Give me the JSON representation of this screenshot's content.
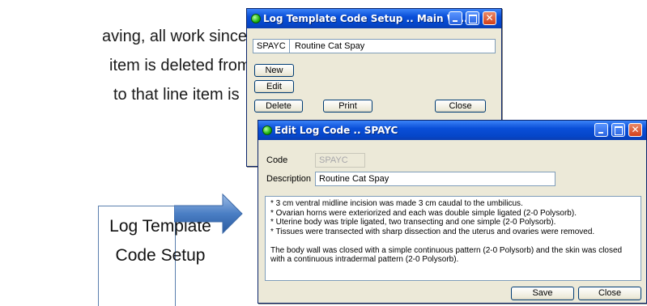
{
  "document": {
    "lines": [
      "aving, all work since",
      "item is deleted from",
      "to that line item is"
    ],
    "callout_lines": [
      "Log Template",
      "Code Setup"
    ]
  },
  "main_window": {
    "title": "Log Template Code Setup .. Main W...",
    "code_value": "SPAYC",
    "description_value": "Routine Cat Spay",
    "buttons": {
      "new": "New",
      "edit": "Edit",
      "delete": "Delete",
      "print": "Print",
      "close": "Close"
    }
  },
  "edit_window": {
    "title": "Edit Log Code .. SPAYC",
    "code_label": "Code",
    "code_value": "SPAYC",
    "description_label": "Description",
    "description_value": "Routine Cat Spay",
    "memo_lines": [
      "*  3 cm ventral midline incision was made 3 cm caudal to the umbilicus.",
      "*  Ovarian horns were exteriorized and each was double simple ligated (2-0 Polysorb).",
      "*  Uterine body was triple ligated, two transecting and one simple (2-0 Polysorb).",
      "*  Tissues were transected with sharp dissection and the uterus and ovaries were removed.",
      "",
      "The body wall was closed with a simple continuous pattern (2-0 Polysorb) and the skin was closed",
      "with a continuous intradermal pattern (2-0 Polysorb)."
    ],
    "buttons": {
      "save": "Save",
      "close": "Close"
    }
  },
  "colors": {
    "titlebar": "#0a4fd8",
    "window_bg": "#ece9d8",
    "arrow": "#4a7ec4",
    "close_button": "#d3401a"
  }
}
